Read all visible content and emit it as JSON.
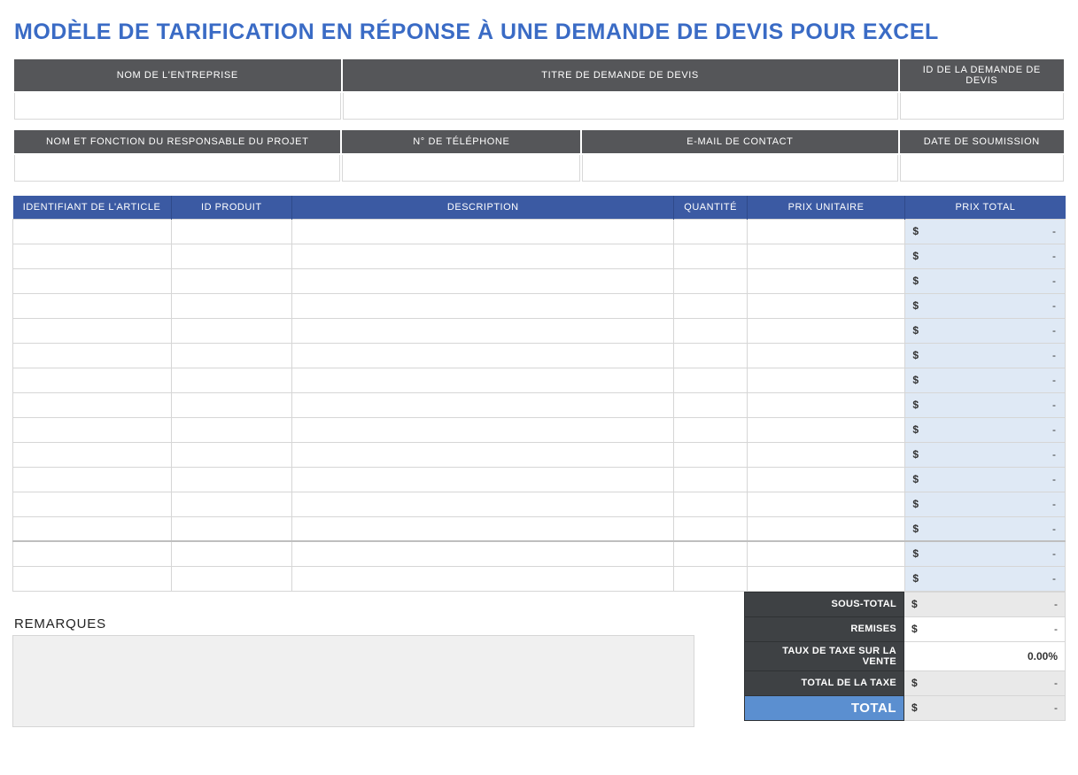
{
  "title": "MODÈLE DE TARIFICATION EN RÉPONSE À UNE DEMANDE DE DEVIS POUR EXCEL",
  "info_row1": {
    "headers": {
      "company": "NOM DE L'ENTREPRISE",
      "rfq_title": "TITRE DE DEMANDE DE DEVIS",
      "rfq_id": "ID DE LA DEMANDE DE DEVIS"
    },
    "values": {
      "company": "",
      "rfq_title": "",
      "rfq_id": ""
    }
  },
  "info_row2": {
    "headers": {
      "contact": "NOM ET FONCTION DU RESPONSABLE DU PROJET",
      "phone": "N° DE TÉLÉPHONE",
      "email": "E-MAIL DE CONTACT",
      "date": "DATE DE SOUMISSION"
    },
    "values": {
      "contact": "",
      "phone": "",
      "email": "",
      "date": ""
    }
  },
  "items": {
    "headers": {
      "article_id": "IDENTIFIANT DE L'ARTICLE",
      "product_id": "ID PRODUIT",
      "description": "DESCRIPTION",
      "quantity": "QUANTITÉ",
      "unit_price": "PRIX UNITAIRE",
      "total_price": "PRIX TOTAL"
    },
    "rows": [
      {
        "article_id": "",
        "product_id": "",
        "description": "",
        "quantity": "",
        "unit_price": "",
        "total_currency": "$",
        "total_dash": "-"
      },
      {
        "article_id": "",
        "product_id": "",
        "description": "",
        "quantity": "",
        "unit_price": "",
        "total_currency": "$",
        "total_dash": "-"
      },
      {
        "article_id": "",
        "product_id": "",
        "description": "",
        "quantity": "",
        "unit_price": "",
        "total_currency": "$",
        "total_dash": "-"
      },
      {
        "article_id": "",
        "product_id": "",
        "description": "",
        "quantity": "",
        "unit_price": "",
        "total_currency": "$",
        "total_dash": "-"
      },
      {
        "article_id": "",
        "product_id": "",
        "description": "",
        "quantity": "",
        "unit_price": "",
        "total_currency": "$",
        "total_dash": "-"
      },
      {
        "article_id": "",
        "product_id": "",
        "description": "",
        "quantity": "",
        "unit_price": "",
        "total_currency": "$",
        "total_dash": "-"
      },
      {
        "article_id": "",
        "product_id": "",
        "description": "",
        "quantity": "",
        "unit_price": "",
        "total_currency": "$",
        "total_dash": "-"
      },
      {
        "article_id": "",
        "product_id": "",
        "description": "",
        "quantity": "",
        "unit_price": "",
        "total_currency": "$",
        "total_dash": "-"
      },
      {
        "article_id": "",
        "product_id": "",
        "description": "",
        "quantity": "",
        "unit_price": "",
        "total_currency": "$",
        "total_dash": "-"
      },
      {
        "article_id": "",
        "product_id": "",
        "description": "",
        "quantity": "",
        "unit_price": "",
        "total_currency": "$",
        "total_dash": "-"
      },
      {
        "article_id": "",
        "product_id": "",
        "description": "",
        "quantity": "",
        "unit_price": "",
        "total_currency": "$",
        "total_dash": "-"
      },
      {
        "article_id": "",
        "product_id": "",
        "description": "",
        "quantity": "",
        "unit_price": "",
        "total_currency": "$",
        "total_dash": "-"
      },
      {
        "article_id": "",
        "product_id": "",
        "description": "",
        "quantity": "",
        "unit_price": "",
        "total_currency": "$",
        "total_dash": "-"
      },
      {
        "article_id": "",
        "product_id": "",
        "description": "",
        "quantity": "",
        "unit_price": "",
        "total_currency": "$",
        "total_dash": "-"
      },
      {
        "article_id": "",
        "product_id": "",
        "description": "",
        "quantity": "",
        "unit_price": "",
        "total_currency": "$",
        "total_dash": "-"
      }
    ]
  },
  "notes": {
    "label": "REMARQUES",
    "value": ""
  },
  "totals": {
    "subtotal": {
      "label": "SOUS-TOTAL",
      "currency": "$",
      "dash": "-"
    },
    "discounts": {
      "label": "REMISES",
      "currency": "$",
      "dash": "-"
    },
    "tax_rate": {
      "label": "TAUX DE TAXE SUR LA VENTE",
      "value": "0.00%"
    },
    "tax_total": {
      "label": "TOTAL DE LA TAXE",
      "currency": "$",
      "dash": "-"
    },
    "grand_total": {
      "label": "TOTAL",
      "currency": "$",
      "dash": "-"
    }
  }
}
